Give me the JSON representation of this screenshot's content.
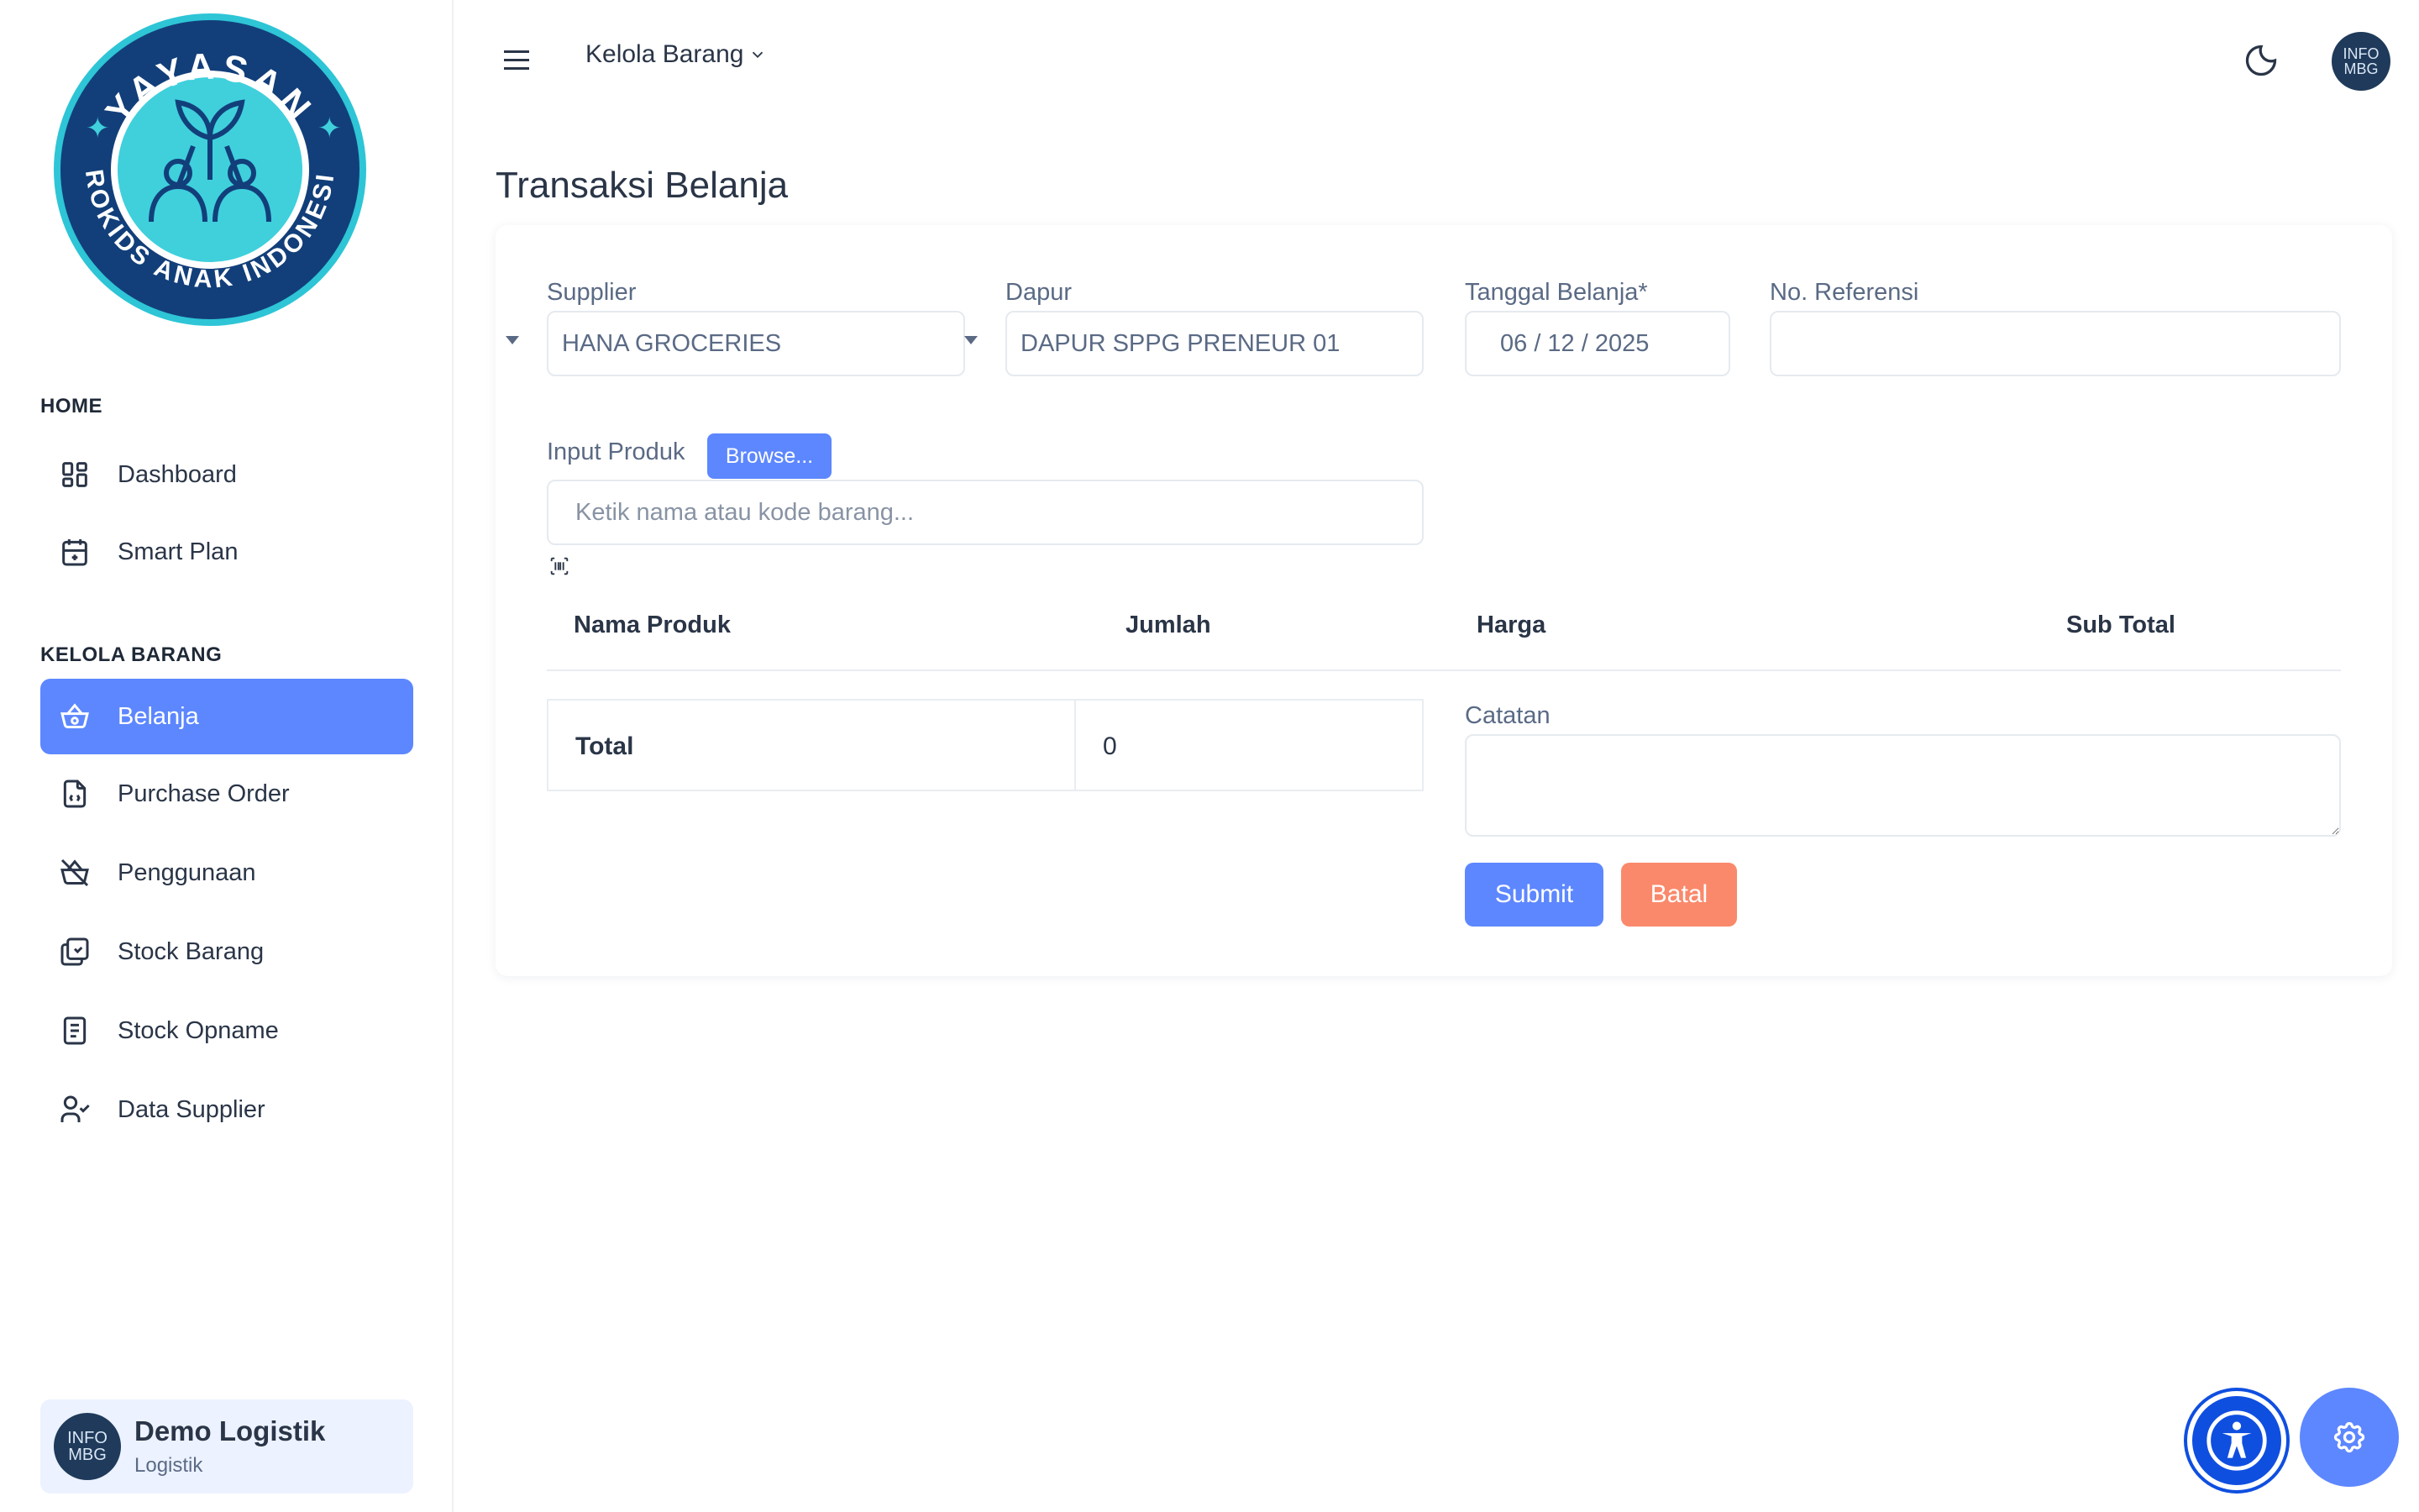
{
  "logo": {
    "top_text": "YAYASAN",
    "bottom_text": "PROKIDS ANAK INDONESIA"
  },
  "sidebar": {
    "sections": [
      {
        "title": "HOME",
        "items": [
          {
            "label": "Dashboard",
            "icon": "dashboard-icon"
          },
          {
            "label": "Smart Plan",
            "icon": "calendar-plus-icon"
          }
        ]
      },
      {
        "title": "KELOLA BARANG",
        "items": [
          {
            "label": "Belanja",
            "icon": "basket-icon",
            "active": true
          },
          {
            "label": "Purchase Order",
            "icon": "file-invoice-icon"
          },
          {
            "label": "Penggunaan",
            "icon": "basket-off-icon"
          },
          {
            "label": "Stock Barang",
            "icon": "box-multiple-icon"
          },
          {
            "label": "Stock Opname",
            "icon": "file-text-icon"
          },
          {
            "label": "Data Supplier",
            "icon": "user-check-icon"
          }
        ]
      }
    ],
    "user": {
      "avatar_line1": "INFO",
      "avatar_line2": "MBG",
      "name": "Demo Logistik",
      "role": "Logistik"
    }
  },
  "header": {
    "breadcrumb": "Kelola Barang",
    "avatar_line1": "INFO",
    "avatar_line2": "MBG"
  },
  "page": {
    "title": "Transaksi Belanja"
  },
  "form": {
    "supplier_label": "Supplier",
    "supplier_value": "HANA GROCERIES",
    "dapur_label": "Dapur",
    "dapur_value": "DAPUR SPPG PRENEUR 01",
    "tanggal_label": "Tanggal Belanja*",
    "tanggal_value": "06 / 12 / 2025",
    "referensi_label": "No. Referensi",
    "referensi_value": "",
    "input_produk_label": "Input Produk",
    "browse_label": "Browse...",
    "input_produk_placeholder": "Ketik nama atau kode barang..."
  },
  "table": {
    "columns": [
      "Nama Produk",
      "Jumlah",
      "Harga",
      "Sub Total"
    ],
    "rows": []
  },
  "totals": {
    "label": "Total",
    "value": "0"
  },
  "notes": {
    "label": "Catatan",
    "value": ""
  },
  "actions": {
    "submit_label": "Submit",
    "cancel_label": "Batal"
  },
  "colors": {
    "primary": "#5d87ff",
    "danger": "#fa896b",
    "logo_navy": "#123f7a",
    "logo_teal": "#2ec5d6"
  }
}
